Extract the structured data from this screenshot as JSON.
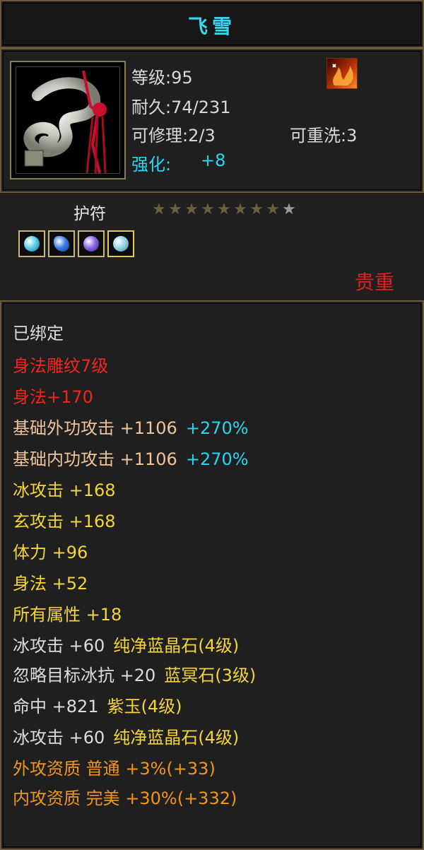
{
  "item": {
    "name": "飞雪"
  },
  "stats": {
    "level": "等级:95",
    "durability": "耐久:74/231",
    "repairable": "可修理:2/3",
    "rewashable": "可重洗:3",
    "enhance_label": "强化:",
    "enhance_value": "+8"
  },
  "item_type": "护符",
  "stars": {
    "filled": 8,
    "total": 9
  },
  "gems": [
    "g1",
    "g2",
    "g3",
    "g4"
  ],
  "rarity": "贵重",
  "colors": {
    "title": "#3ad6f0",
    "rarity": "#e61e1e",
    "cyan": "#27d7f0",
    "yellow": "#f5d33a",
    "orange": "#f0961e",
    "red": "#f2261e"
  },
  "attributes": [
    {
      "parts": [
        "已绑定"
      ],
      "colors": [
        "c-white"
      ]
    },
    {
      "parts": [
        "身法雕纹7级"
      ],
      "colors": [
        "c-red"
      ]
    },
    {
      "parts": [
        "身法+170"
      ],
      "colors": [
        "c-red"
      ]
    },
    {
      "parts": [
        "基础外功攻击 +1106",
        "+270%"
      ],
      "colors": [
        "c-peach",
        "c-cyan"
      ]
    },
    {
      "parts": [
        "基础内功攻击 +1106",
        "+270%"
      ],
      "colors": [
        "c-peach",
        "c-cyan"
      ]
    },
    {
      "parts": [
        "冰攻击 +168"
      ],
      "colors": [
        "c-yellow"
      ]
    },
    {
      "parts": [
        "玄攻击 +168"
      ],
      "colors": [
        "c-yellow"
      ]
    },
    {
      "parts": [
        "体力 +96"
      ],
      "colors": [
        "c-yellow"
      ]
    },
    {
      "parts": [
        "身法 +52"
      ],
      "colors": [
        "c-yellow"
      ]
    },
    {
      "parts": [
        "所有属性 +18"
      ],
      "colors": [
        "c-yellow"
      ]
    },
    {
      "parts": [
        "冰攻击 +60",
        "纯净蓝晶石(4级)"
      ],
      "colors": [
        "c-white",
        "c-yellow"
      ]
    },
    {
      "parts": [
        "忽略目标冰抗 +20",
        "蓝冥石(3级)"
      ],
      "colors": [
        "c-white",
        "c-yellow"
      ]
    },
    {
      "parts": [
        "命中 +821",
        "紫玉(4级)"
      ],
      "colors": [
        "c-white",
        "c-yellow"
      ]
    },
    {
      "parts": [
        "冰攻击 +60",
        "纯净蓝晶石(4级)"
      ],
      "colors": [
        "c-white",
        "c-yellow"
      ]
    },
    {
      "parts": [
        "外攻资质 普通 +3%(+33)"
      ],
      "colors": [
        "c-orange"
      ]
    },
    {
      "parts": [
        "内攻资质 完美 +30%(+332)"
      ],
      "colors": [
        "c-orange"
      ]
    }
  ]
}
